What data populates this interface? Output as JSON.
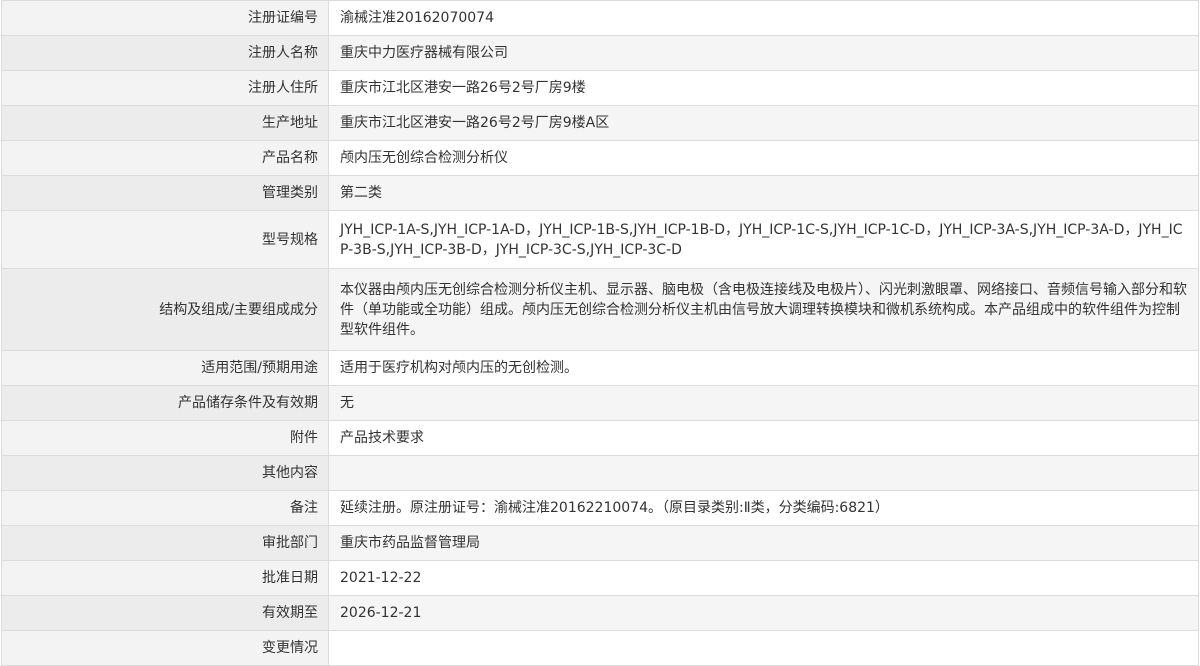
{
  "rows": [
    {
      "label": "注册证编号",
      "value": "渝械注准20162070074"
    },
    {
      "label": "注册人名称",
      "value": "重庆中力医疗器械有限公司"
    },
    {
      "label": "注册人住所",
      "value": "重庆市江北区港安一路26号2号厂房9楼"
    },
    {
      "label": "生产地址",
      "value": "重庆市江北区港安一路26号2号厂房9楼A区"
    },
    {
      "label": "产品名称",
      "value": "颅内压无创综合检测分析仪"
    },
    {
      "label": "管理类别",
      "value": "第二类"
    },
    {
      "label": "型号规格",
      "value": "JYH_ICP-1A-S,JYH_ICP-1A-D，JYH_ICP-1B-S,JYH_ICP-1B-D，JYH_ICP-1C-S,JYH_ICP-1C-D，JYH_ICP-3A-S,JYH_ICP-3A-D，JYH_ICP-3B-S,JYH_ICP-3B-D，JYH_ICP-3C-S,JYH_ICP-3C-D"
    },
    {
      "label": "结构及组成/主要组成成分",
      "value": "本仪器由颅内压无创综合检测分析仪主机、显示器、脑电极（含电极连接线及电极片）、闪光刺激眼罩、网络接口、音频信号输入部分和软件（单功能或全功能）组成。颅内压无创综合检测分析仪主机由信号放大调理转换模块和微机系统构成。本产品组成中的软件组件为控制型软件组件。"
    },
    {
      "label": "适用范围/预期用途",
      "value": "适用于医疗机构对颅内压的无创检测。"
    },
    {
      "label": "产品储存条件及有效期",
      "value": "无"
    },
    {
      "label": "附件",
      "value": "产品技术要求"
    },
    {
      "label": "其他内容",
      "value": ""
    },
    {
      "label": "备注",
      "value": "延续注册。原注册证号：渝械注准20162210074。（原目录类别:Ⅱ类，分类编码:6821）"
    },
    {
      "label": "审批部门",
      "value": "重庆市药品监督管理局"
    },
    {
      "label": "批准日期",
      "value": "2021-12-22"
    },
    {
      "label": "有效期至",
      "value": "2026-12-21"
    },
    {
      "label": "变更情况",
      "value": ""
    }
  ]
}
